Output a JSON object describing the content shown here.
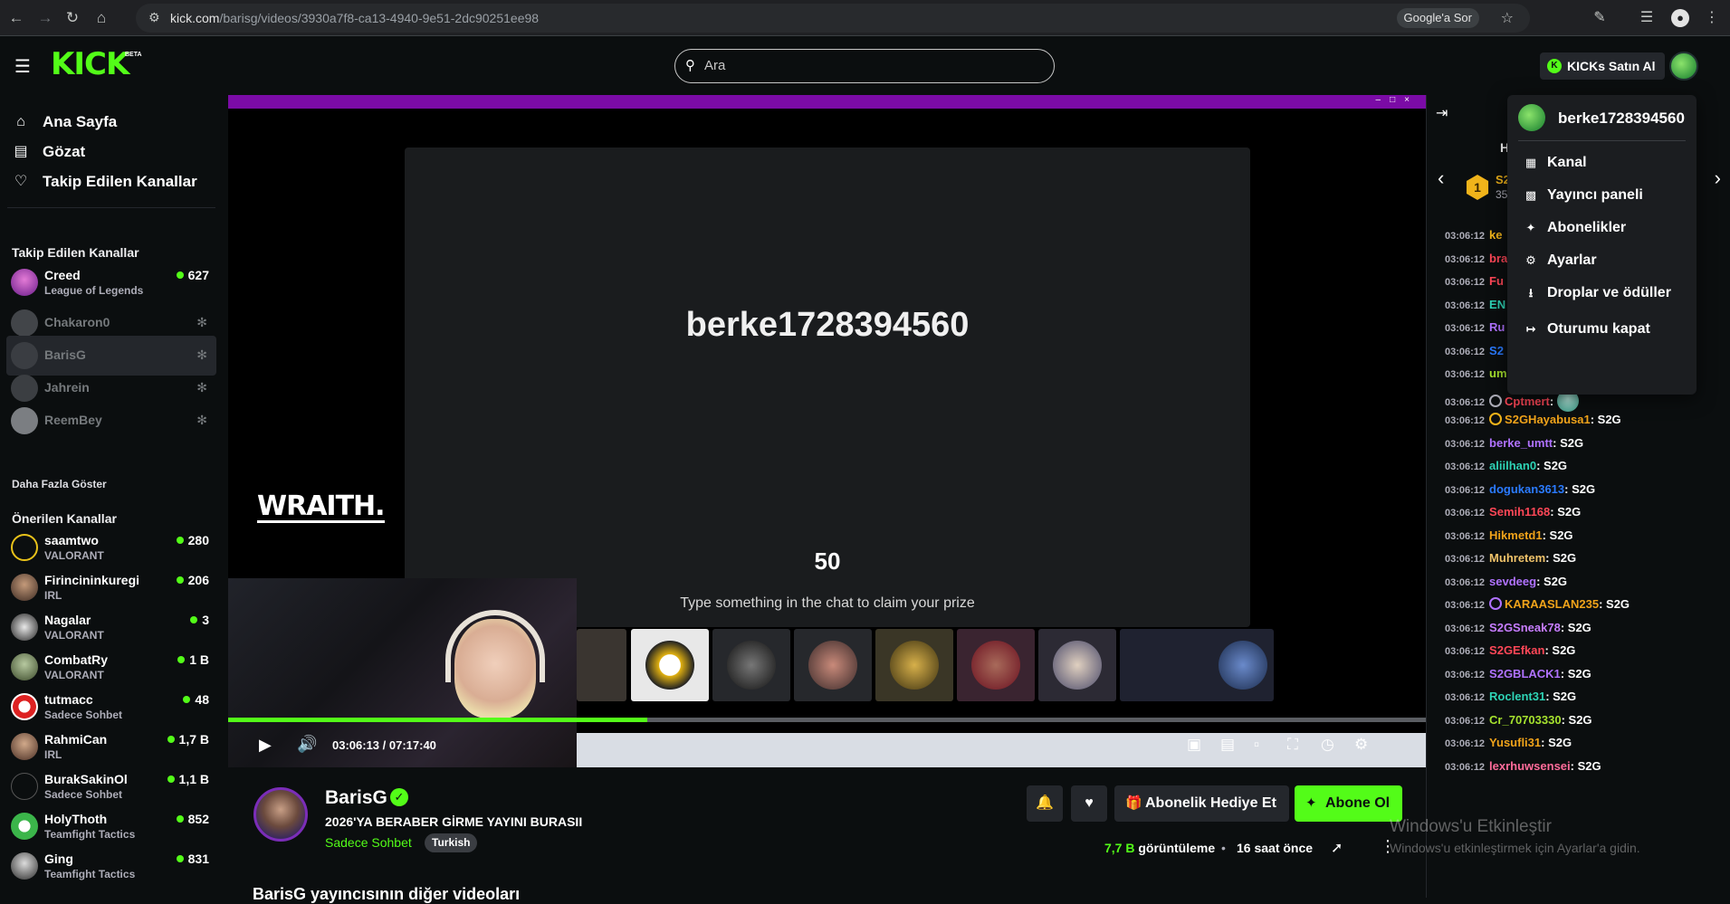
{
  "browser": {
    "url_host": "kick.com",
    "url_path": "/barisg/videos/3930a7f8-ca13-4940-9e51-2dc90251ee98",
    "google_sor": "Google'a Sor"
  },
  "header": {
    "logo": "KICK",
    "beta": "BETA",
    "search_placeholder": "Ara",
    "buy_kicks": "KICKs Satın Al"
  },
  "sidebar": {
    "nav": [
      {
        "label": "Ana Sayfa",
        "icon": "home-icon"
      },
      {
        "label": "Gözat",
        "icon": "browse-icon"
      },
      {
        "label": "Takip Edilen Kanallar",
        "icon": "heart-icon"
      }
    ],
    "followed_heading": "Takip Edilen Kanallar",
    "followed": [
      {
        "name": "Creed",
        "sub": "League of Legends",
        "count": "627",
        "live": true
      },
      {
        "name": "Chakaron0",
        "live": false
      },
      {
        "name": "BarisG",
        "live": false,
        "active": true
      },
      {
        "name": "Jahrein",
        "live": false
      },
      {
        "name": "ReemBey",
        "live": false
      }
    ],
    "show_more": "Daha Fazla Göster",
    "recommended_heading": "Önerilen Kanallar",
    "recommended": [
      {
        "name": "saamtwo",
        "sub": "VALORANT",
        "count": "280"
      },
      {
        "name": "Firincininkuregi",
        "sub": "IRL",
        "count": "206"
      },
      {
        "name": "Nagalar",
        "sub": "VALORANT",
        "count": "3"
      },
      {
        "name": "CombatRy",
        "sub": "VALORANT",
        "count": "1 B"
      },
      {
        "name": "tutmacc",
        "sub": "Sadece Sohbet",
        "count": "48"
      },
      {
        "name": "RahmiCan",
        "sub": "IRL",
        "count": "1,7 B"
      },
      {
        "name": "BurakSakinOl",
        "sub": "Sadece Sohbet",
        "count": "1,1 B"
      },
      {
        "name": "HolyThoth",
        "sub": "Teamfight Tactics",
        "count": "852"
      },
      {
        "name": "Ging",
        "sub": "Teamfight Tactics",
        "count": "831"
      }
    ]
  },
  "player": {
    "card_username": "berke1728394560",
    "card_number": "50",
    "card_hint": "Type something in the chat to claim your prize",
    "wraith": "WRAITH.",
    "progress": 0.35,
    "time": "03:06:13 / 07:17:40"
  },
  "stream": {
    "name": "BarisG",
    "title": "2026'YA BERABER GİRME YAYINI BURASII",
    "category": "Sadece Sohbet",
    "language": "Turkish",
    "gift_label": "Abonelik Hediye Et",
    "subscribe_label": "Abone Ol",
    "views_value": "7,7 B",
    "views_label": "görüntüleme",
    "ago": "16 saat önce",
    "other_videos": "BarisG yayıncısının diğer videoları"
  },
  "chat": {
    "head": "H",
    "leader_rank": "1",
    "leader_name": "S2",
    "leader_pts": "35",
    "messages": [
      {
        "time": "03:06:12",
        "user": "ke",
        "color": "#f0b31a",
        "text": ""
      },
      {
        "time": "03:06:12",
        "user": "bra",
        "color": "#ff4757",
        "text": ""
      },
      {
        "time": "03:06:12",
        "user": "Fu",
        "color": "#ff4757",
        "text": ""
      },
      {
        "time": "03:06:12",
        "user": "EN",
        "color": "#2ed3b5",
        "text": ""
      },
      {
        "time": "03:06:12",
        "user": "Ru",
        "color": "#b072ff",
        "text": ""
      },
      {
        "time": "03:06:12",
        "user": "S2",
        "color": "#2b7bff",
        "text": ""
      },
      {
        "time": "03:06:12",
        "user": "umutargos",
        "color": "#a6e22e",
        "text": ": S2G"
      },
      {
        "time": "03:06:12",
        "user": "Cptmert",
        "color": "#ff4757",
        "text": ":",
        "badge": "grey",
        "emote": true
      },
      {
        "time": "03:06:12",
        "user": "S2GHayabusa1",
        "color": "#f0a31a",
        "text": ": S2G",
        "badge": "yellow"
      },
      {
        "time": "03:06:12",
        "user": "berke_umtt",
        "color": "#b072ff",
        "text": ": S2G"
      },
      {
        "time": "03:06:12",
        "user": "aliilhan0",
        "color": "#2ed3b5",
        "text": ": S2G"
      },
      {
        "time": "03:06:12",
        "user": "dogukan3613",
        "color": "#2b7bff",
        "text": ": S2G"
      },
      {
        "time": "03:06:12",
        "user": "Semih1168",
        "color": "#ff4757",
        "text": ": S2G"
      },
      {
        "time": "03:06:12",
        "user": "Hikmetd1",
        "color": "#f0a31a",
        "text": ": S2G"
      },
      {
        "time": "03:06:12",
        "user": "Muhretem",
        "color": "#f0c36a",
        "text": ": S2G"
      },
      {
        "time": "03:06:12",
        "user": "sevdeeg",
        "color": "#b072ff",
        "text": ": S2G"
      },
      {
        "time": "03:06:12",
        "user": "KARAASLAN235",
        "color": "#f0a31a",
        "text": ": S2G",
        "badge": "purple"
      },
      {
        "time": "03:06:12",
        "user": "S2GSneak78",
        "color": "#c77dff",
        "text": ": S2G"
      },
      {
        "time": "03:06:12",
        "user": "S2GEfkan",
        "color": "#ff4757",
        "text": ": S2G"
      },
      {
        "time": "03:06:12",
        "user": "S2GBLACK1",
        "color": "#b072ff",
        "text": ": S2G"
      },
      {
        "time": "03:06:12",
        "user": "Roclent31",
        "color": "#2ed3b5",
        "text": ": S2G"
      },
      {
        "time": "03:06:12",
        "user": "Cr_70703330",
        "color": "#a6e22e",
        "text": ": S2G"
      },
      {
        "time": "03:06:12",
        "user": "Yusufli31",
        "color": "#f0a31a",
        "text": ": S2G"
      },
      {
        "time": "03:06:12",
        "user": "lexrhuwsensei",
        "color": "#ff6b9a",
        "text": ": S2G"
      }
    ]
  },
  "watermark": {
    "line1": "Windows'u Etkinleştir",
    "line2": "Windows'u etkinleştirmek için Ayarlar'a gidin."
  },
  "menu": {
    "username": "berke1728394560",
    "items": [
      {
        "label": "Kanal",
        "icon": "channel-icon"
      },
      {
        "label": "Yayıncı paneli",
        "icon": "dashboard-icon"
      },
      {
        "label": "Abonelikler",
        "icon": "sparkle-icon"
      },
      {
        "label": "Ayarlar",
        "icon": "gear-icon"
      },
      {
        "label": "Droplar ve ödüller",
        "icon": "drops-icon"
      },
      {
        "label": "Oturumu kapat",
        "icon": "logout-icon"
      }
    ]
  },
  "colors": {
    "accent": "#53fc18",
    "bg": "#0b0e0f",
    "panel": "#24272c",
    "menu_bg": "#1b1d20"
  }
}
